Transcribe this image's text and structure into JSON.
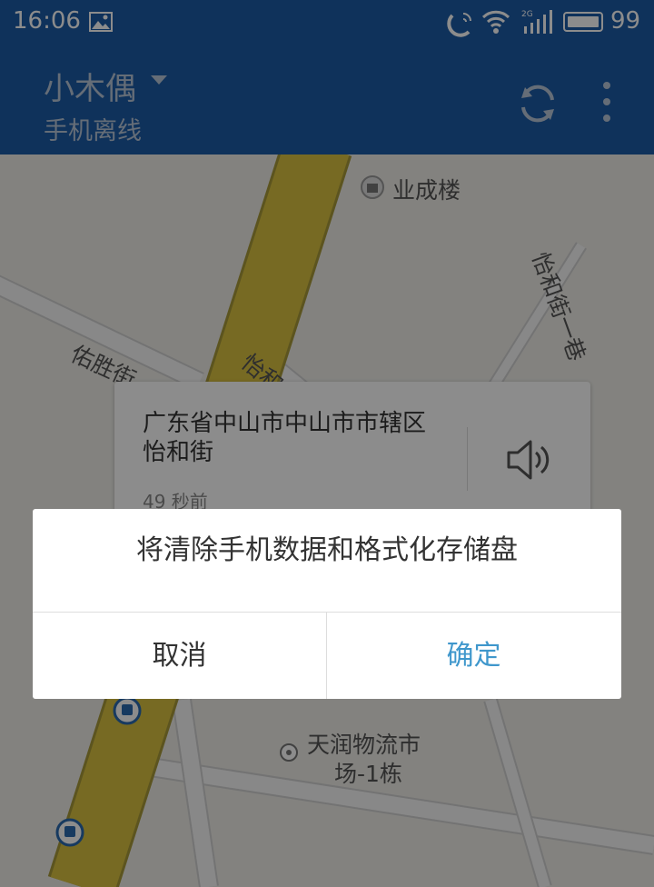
{
  "status_bar": {
    "time": "16:06",
    "battery_percent": "99",
    "icons": [
      "image-icon",
      "nfc-icon",
      "wifi-icon",
      "signal-2g-icon",
      "battery-icon"
    ]
  },
  "app_bar": {
    "device_name": "小木偶",
    "device_status": "手机离线",
    "actions": [
      "refresh-icon",
      "more-icon"
    ]
  },
  "map": {
    "labels": {
      "building": "业成楼",
      "road1": "佑胜街",
      "road2": "怡和街",
      "road3": "怡和街一巷",
      "poi_line1": "天润物流市",
      "poi_line2": "场-1栋"
    }
  },
  "info_card": {
    "address": "广东省中山市中山市市辖区怡和街",
    "time_ago": "49 秒前"
  },
  "dialog": {
    "message": "将清除手机数据和格式化存储盘",
    "cancel": "取消",
    "confirm": "确定"
  },
  "colors": {
    "app_bar": "#1d5ca6",
    "confirm_text": "#3f97cc",
    "main_road": "#d9c140"
  }
}
